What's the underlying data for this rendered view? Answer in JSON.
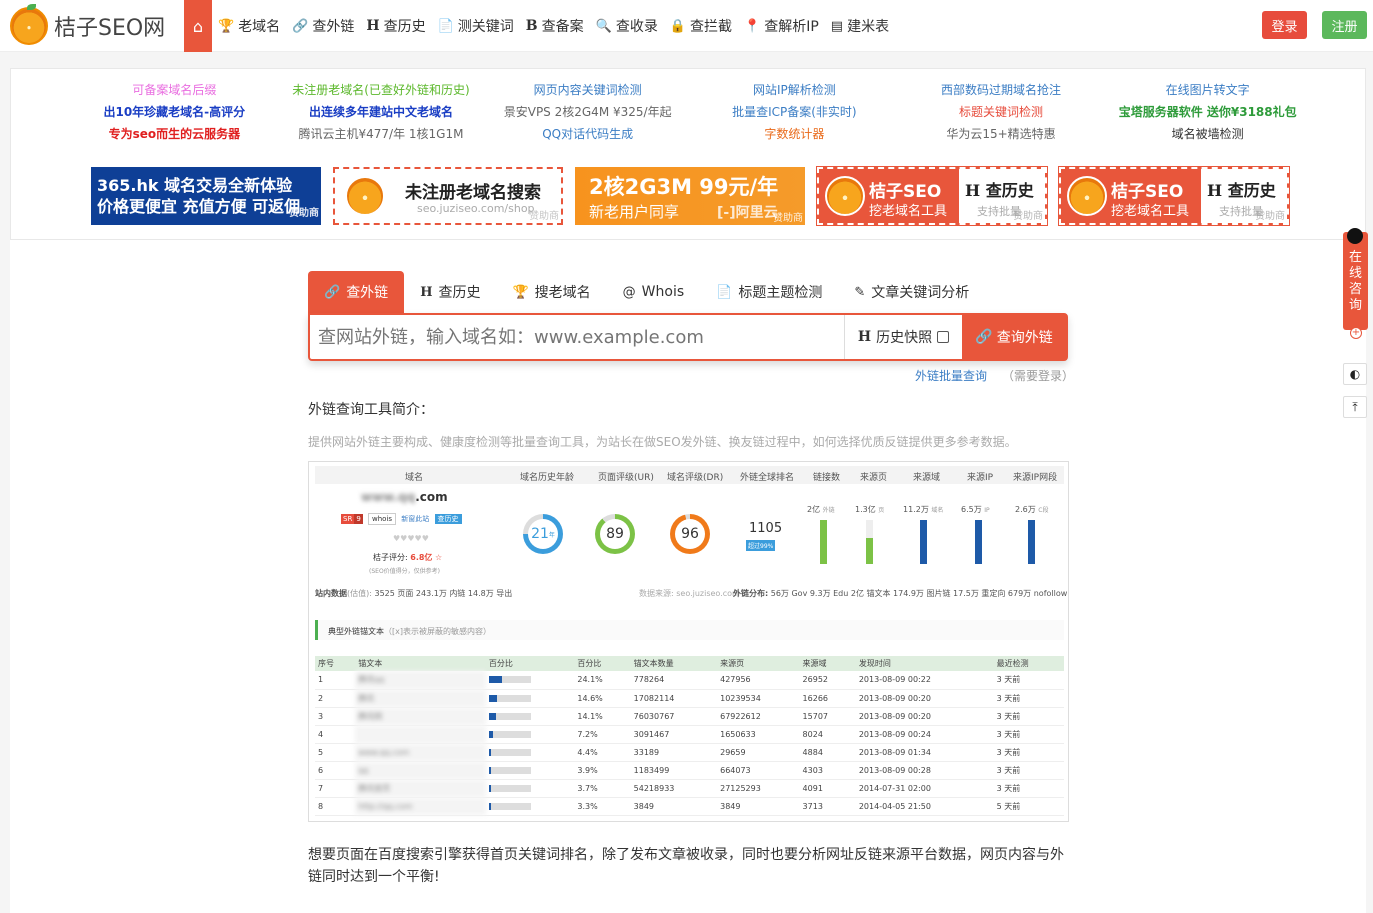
{
  "brand": {
    "name": "桔子SEO网"
  },
  "nav": {
    "items": [
      {
        "icon": "trophy-icon",
        "glyph": "🏆",
        "label": "老域名"
      },
      {
        "icon": "link-icon",
        "glyph": "🔗",
        "label": "查外链"
      },
      {
        "icon": "h-icon",
        "glyph": "H",
        "label": "查历史"
      },
      {
        "icon": "document-icon",
        "glyph": "📄",
        "label": "测关键词"
      },
      {
        "icon": "b-icon",
        "glyph": "B",
        "label": "查备案"
      },
      {
        "icon": "search-icon",
        "glyph": "🔍",
        "label": "查收录"
      },
      {
        "icon": "lock-icon",
        "glyph": "🔒",
        "label": "查拦截"
      },
      {
        "icon": "location-icon",
        "glyph": "📍",
        "label": "查解析IP"
      },
      {
        "icon": "table-icon",
        "glyph": "▤",
        "label": "建米表"
      }
    ],
    "login": "登录",
    "register": "注册"
  },
  "promo_links": [
    {
      "text": "可备案域名后缀",
      "color": "#e96ee0"
    },
    {
      "text": "未注册老域名(已查好外链和历史)",
      "color": "#5cb82c"
    },
    {
      "text": "网页内容关键词检测",
      "color": "#3b7dc4"
    },
    {
      "text": "网站IP解析检测",
      "color": "#3b7dc4"
    },
    {
      "text": "西部数码过期域名抢注",
      "color": "#3b7dc4"
    },
    {
      "text": "在线图片转文字",
      "color": "#3b7dc4"
    },
    {
      "text": "出10年珍藏老域名-高评分",
      "color": "#1a3ec4"
    },
    {
      "text": "出连续多年建站中文老域名",
      "color": "#1a3ec4"
    },
    {
      "text": "景安VPS 2核2G4M ¥325/年起",
      "color": "#666666"
    },
    {
      "text": "批量查ICP备案(非实时)",
      "color": "#3b7dc4"
    },
    {
      "text": "标题关键词检测",
      "color": "#e74c3c"
    },
    {
      "text": "宝塔服务器软件 送你¥3188礼包",
      "color": "#2e9b3a"
    },
    {
      "text": "专为seo而生的云服务器",
      "color": "#e02020"
    },
    {
      "text": "腾讯云主机¥477/年 1核1G1M",
      "color": "#666666"
    },
    {
      "text": "QQ对话代码生成",
      "color": "#3b7dc4"
    },
    {
      "text": "字数统计器",
      "color": "#e96a1a"
    },
    {
      "text": "华为云15+精选特惠",
      "color": "#666666"
    },
    {
      "text": "域名被墙检测",
      "color": "#333333"
    }
  ],
  "banners": {
    "b1": {
      "line1": "365.hk 域名交易全新体验",
      "line2": "价格更便宜 充值方便 可返佣",
      "sponsor": "赞助商"
    },
    "b2": {
      "title": "未注册老域名搜索",
      "url": "seo.juziseo.com/shop",
      "sponsor": "赞助商"
    },
    "b3": {
      "line1": "2核2G3M 99元/年",
      "line2": "新老用户同享",
      "brand": "[-]阿里云",
      "sponsor": "赞助商"
    },
    "b4": {
      "brand": "桔子SEO",
      "sub": "挖老域名工具",
      "title": "查历史",
      "note": "支持批量",
      "sponsor": "赞助商"
    },
    "b5": {
      "brand": "桔子SEO",
      "sub": "挖老域名工具",
      "title": "查历史",
      "note": "支持批量",
      "sponsor": "赞助商"
    }
  },
  "tabs": [
    {
      "icon": "link-icon",
      "glyph": "🔗",
      "label": "查外链",
      "active": true
    },
    {
      "icon": "h-icon",
      "glyph": "H",
      "label": "查历史"
    },
    {
      "icon": "trophy-icon",
      "glyph": "🏆",
      "label": "搜老域名"
    },
    {
      "icon": "at-icon",
      "glyph": "@",
      "label": "Whois"
    },
    {
      "icon": "document-icon",
      "glyph": "📄",
      "label": "标题主题检测"
    },
    {
      "icon": "edit-icon",
      "glyph": "✎",
      "label": "文章关键词分析"
    }
  ],
  "search": {
    "placeholder": "查网站外链，输入域名如：www.example.com",
    "history_label": "历史快照",
    "button": "查询外链",
    "batch_link": "外链批量查询",
    "batch_note": "（需要登录）"
  },
  "intro": {
    "heading": "外链查询工具简介：",
    "desc": "提供网站外链主要构成、健康度检测等批量查询工具，为站长在做SEO发外链、换友链过程中，如何选择优质反链提供更多参考数据。"
  },
  "sample": {
    "headers": [
      "域名",
      "域名历史年龄",
      "页面评级(UR)",
      "域名评级(DR)",
      "外链全球排名",
      "链接数",
      "来源页",
      "来源域",
      "来源IP",
      "来源IP网段"
    ],
    "domain": "www.qq.com",
    "domain_suffix": ".com",
    "sr": "SR",
    "sr_val": "9",
    "whois": "whois",
    "new_open": "新窗此站",
    "history": "查历史",
    "score_label": "桔子评分:",
    "score_val": "6.8亿",
    "score_note": "(SEO价值得分，仅供参考)",
    "age": "21",
    "age_unit": "年",
    "ur": "89",
    "dr": "96",
    "rank": "1105",
    "rank_note": "超过99%",
    "links": "2亿",
    "links_unit": "外链",
    "pages": "1.3亿",
    "pages_unit": "页",
    "domains": "11.2万",
    "domains_unit": "域名",
    "ips": "6.5万",
    "ips_unit": "IP",
    "segments": "2.6万",
    "segments_unit": "C段",
    "site_data_label": "站内数据",
    "site_data_sub": "(估值):",
    "site_data": "3525 页面   243.1万 内链   14.8万 导出",
    "source": "数据来源: seo.juziseo.com",
    "dist_label": "外链分布:",
    "dist": "56万 Gov   9.3万 Edu   2亿 锚文本   174.9万 图片链   17.5万 重定向   679万 nofollow",
    "anchor_title": "典型外链锚文本",
    "anchor_note": "（[x]表示被屏蔽的敏感内容）",
    "table_headers": [
      "序号",
      "锚文本",
      "百分比",
      "百分比",
      "锚文本数量",
      "来源页",
      "来源域",
      "发现时间",
      "最近检测"
    ],
    "rows": [
      {
        "n": "1",
        "a": "腾讯qq",
        "p": 0.241,
        "pct": "24.1%",
        "cnt": "778264",
        "pg": "427956",
        "dm": "26952",
        "t": "2013-08-09 00:22",
        "c": "3 天前"
      },
      {
        "n": "2",
        "a": "腾讯",
        "p": 0.146,
        "pct": "14.6%",
        "cnt": "17082114",
        "pg": "10239534",
        "dm": "16266",
        "t": "2013-08-09 00:20",
        "c": "3 天前"
      },
      {
        "n": "3",
        "a": "腾讯网",
        "p": 0.141,
        "pct": "14.1%",
        "cnt": "76030767",
        "pg": "67922612",
        "dm": "15707",
        "t": "2013-08-09 00:20",
        "c": "3 天前"
      },
      {
        "n": "4",
        "a": "",
        "p": 0.072,
        "pct": "7.2%",
        "cnt": "3091467",
        "pg": "1650633",
        "dm": "8024",
        "t": "2013-08-09 00:24",
        "c": "3 天前"
      },
      {
        "n": "5",
        "a": "www.qq.com",
        "p": 0.044,
        "pct": "4.4%",
        "cnt": "33189",
        "pg": "29659",
        "dm": "4884",
        "t": "2013-08-09 01:34",
        "c": "3 天前"
      },
      {
        "n": "6",
        "a": "qq",
        "p": 0.039,
        "pct": "3.9%",
        "cnt": "1183499",
        "pg": "664073",
        "dm": "4303",
        "t": "2013-08-09 00:28",
        "c": "3 天前"
      },
      {
        "n": "7",
        "a": "腾讯首页",
        "p": 0.037,
        "pct": "3.7%",
        "cnt": "54218933",
        "pg": "27125293",
        "dm": "4091",
        "t": "2014-07-31 02:00",
        "c": "3 天前"
      },
      {
        "n": "8",
        "a": "http://qq.com",
        "p": 0.033,
        "pct": "3.3%",
        "cnt": "3849",
        "pg": "3849",
        "dm": "3713",
        "t": "2014-04-05 21:50",
        "c": "5 天前"
      }
    ]
  },
  "outro": "想要页面在百度搜索引擎获得首页关键词排名，除了发布文章被收录，同时也要分析网址反链来源平台数据，网页内容与外链同时达到一个平衡!",
  "float": {
    "consult": "在线咨询"
  }
}
